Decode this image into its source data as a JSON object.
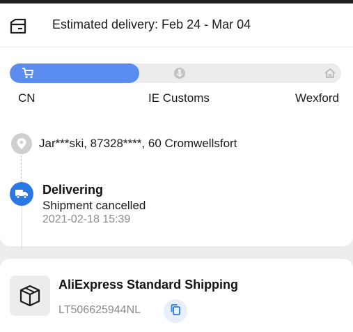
{
  "delivery": {
    "estimated_text": "Estimated delivery: Feb 24 - Mar 04",
    "icon": "delivery-box-icon"
  },
  "progress": {
    "fraction": 0.39,
    "stages": [
      {
        "label": "CN",
        "icon": "cart-icon",
        "active": true
      },
      {
        "label": "IE Customs",
        "icon": "customs-anchor-icon",
        "active": false
      },
      {
        "label": "Wexford",
        "icon": "home-icon",
        "active": false
      }
    ],
    "colors": {
      "fill": "#5b8cf0",
      "track": "#ececec"
    }
  },
  "address": {
    "text": "Jar***ski,  87328****,  60 Cromwellsfort",
    "icon": "location-pin-icon"
  },
  "event": {
    "title": "Delivering",
    "description": "Shipment cancelled",
    "time": "2021-02-18 15:39",
    "icon": "truck-icon",
    "color": "#2b78e4"
  },
  "shipping": {
    "method": "AliExpress Standard Shipping",
    "tracking_number": "LT506625944NL",
    "icon": "package-icon",
    "copy_icon": "copy-icon"
  }
}
